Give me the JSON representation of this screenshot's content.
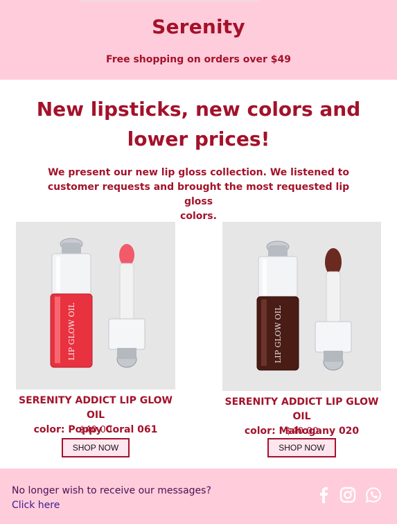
{
  "header": {
    "brand": "Serenity",
    "shipping_note": "Free shopping on orders over $49"
  },
  "main": {
    "headline_line1": "New lipsticks, new colors and",
    "headline_line2": "lower prices!",
    "intro_line1": "We present our new lip gloss collection. We listened to",
    "intro_line2": "customer requests and brought the most requested lip gloss",
    "intro_line3": "colors."
  },
  "products": [
    {
      "name": "SERENITY ADDICT LIP GLOW OIL",
      "color": "color: Poppy Coral 061",
      "price": "$40.00",
      "button": "SHOP NOW",
      "bottle_text": "LIP GLOW OIL",
      "oil_color": "#e8323f",
      "tip_color": "#f25a6a"
    },
    {
      "name": "SERENITY ADDICT LIP GLOW OIL",
      "color": "color: Mahogany 020",
      "price": "$40.00",
      "button": "SHOP NOW",
      "bottle_text": "LIP GLOW OIL",
      "oil_color": "#4a1c16",
      "tip_color": "#6a2a20"
    }
  ],
  "footer": {
    "unsubscribe_text": "No longer wish to receive our messages?",
    "click_here": "Click here",
    "social_icons": [
      "facebook-icon",
      "instagram-icon",
      "whatsapp-icon"
    ]
  },
  "colors": {
    "brand": "#a3122a",
    "pink_bg": "#ffccdc",
    "link": "#3a1c8e"
  }
}
